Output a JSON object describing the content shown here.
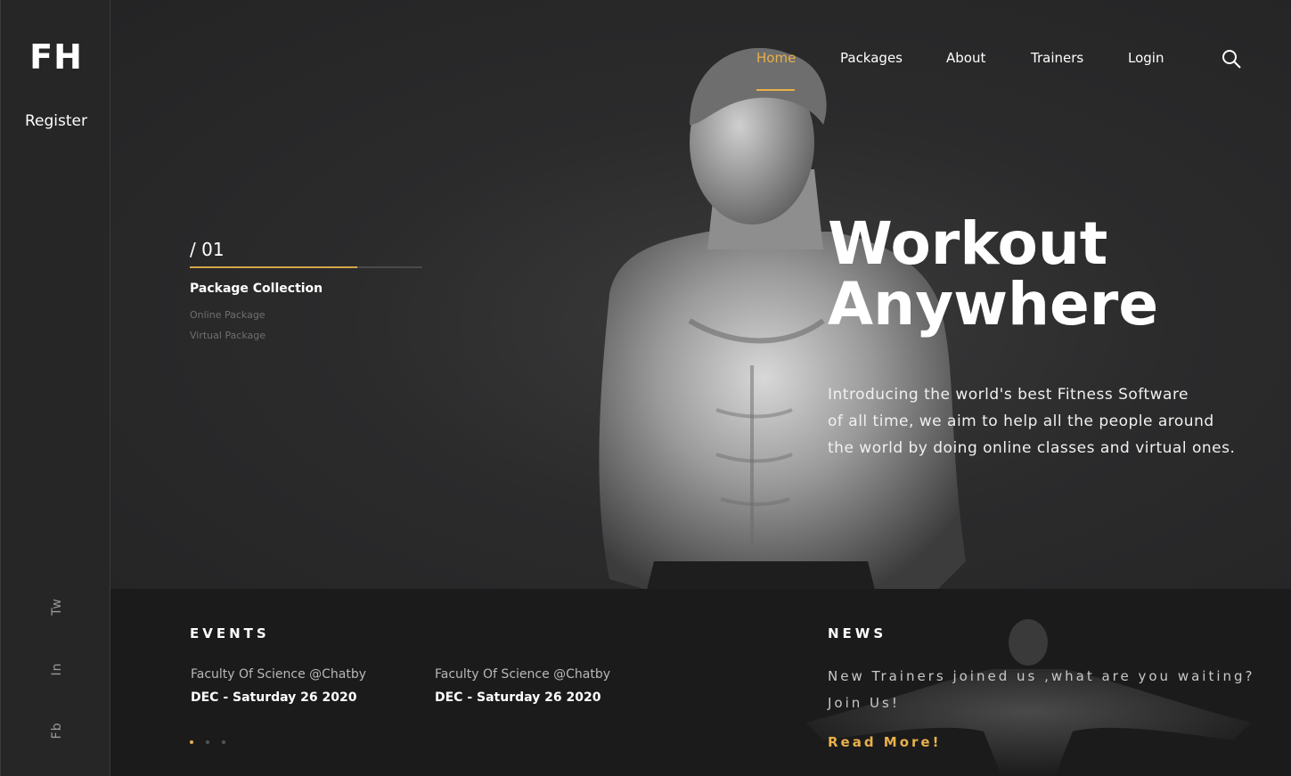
{
  "sidebar": {
    "logo": "FH",
    "register": "Register",
    "social": [
      "Tw",
      "In",
      "Fb"
    ]
  },
  "nav": {
    "items": [
      "Home",
      "Packages",
      "About",
      "Trainers",
      "Login"
    ],
    "active": "Home",
    "search_icon": "search-icon"
  },
  "slider": {
    "number": "/ 01",
    "progress": 0.72,
    "title": "Package Collection",
    "links": [
      "Online Package",
      "Virtual Package"
    ]
  },
  "hero": {
    "headline_line1": "Workout",
    "headline_line2": "Anywhere",
    "intro_line1": "Introducing the world's best Fitness Software",
    "intro_line2": "of all time, we aim to help all the people around",
    "intro_line3": "the world by doing online classes and virtual ones."
  },
  "events": {
    "title": "EVENTS",
    "items": [
      {
        "venue": "Faculty Of Science @Chatby",
        "date": "DEC - Saturday 26 2020"
      },
      {
        "venue": "Faculty Of Science @Chatby",
        "date": "DEC - Saturday 26 2020"
      }
    ],
    "dots": 3,
    "active_dot": 0
  },
  "news": {
    "title": "NEWS",
    "line1": "New Trainers joined us ,what are you waiting?",
    "line2": "Join Us!",
    "read_more": "Read More!"
  },
  "colors": {
    "accent": "#e8b04a",
    "background": "#2a2a2b",
    "band": "#1b1b1c"
  }
}
